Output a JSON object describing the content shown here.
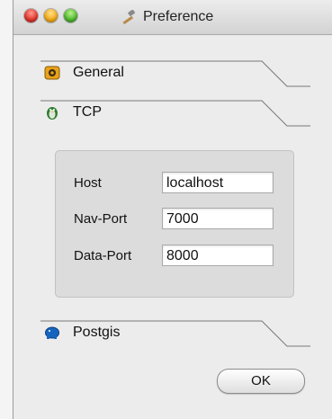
{
  "window": {
    "title": "Preference"
  },
  "sections": {
    "general": {
      "label": "General",
      "icon": "general-box-icon"
    },
    "tcp": {
      "label": "TCP",
      "icon": "tcp-penguin-icon"
    },
    "postgis": {
      "label": "Postgis",
      "icon": "postgis-elephant-icon"
    }
  },
  "tcp_form": {
    "host": {
      "label": "Host",
      "value": "localhost"
    },
    "nav_port": {
      "label": "Nav-Port",
      "value": "7000"
    },
    "data_port": {
      "label": "Data-Port",
      "value": "8000"
    }
  },
  "actions": {
    "ok_label": "OK"
  }
}
